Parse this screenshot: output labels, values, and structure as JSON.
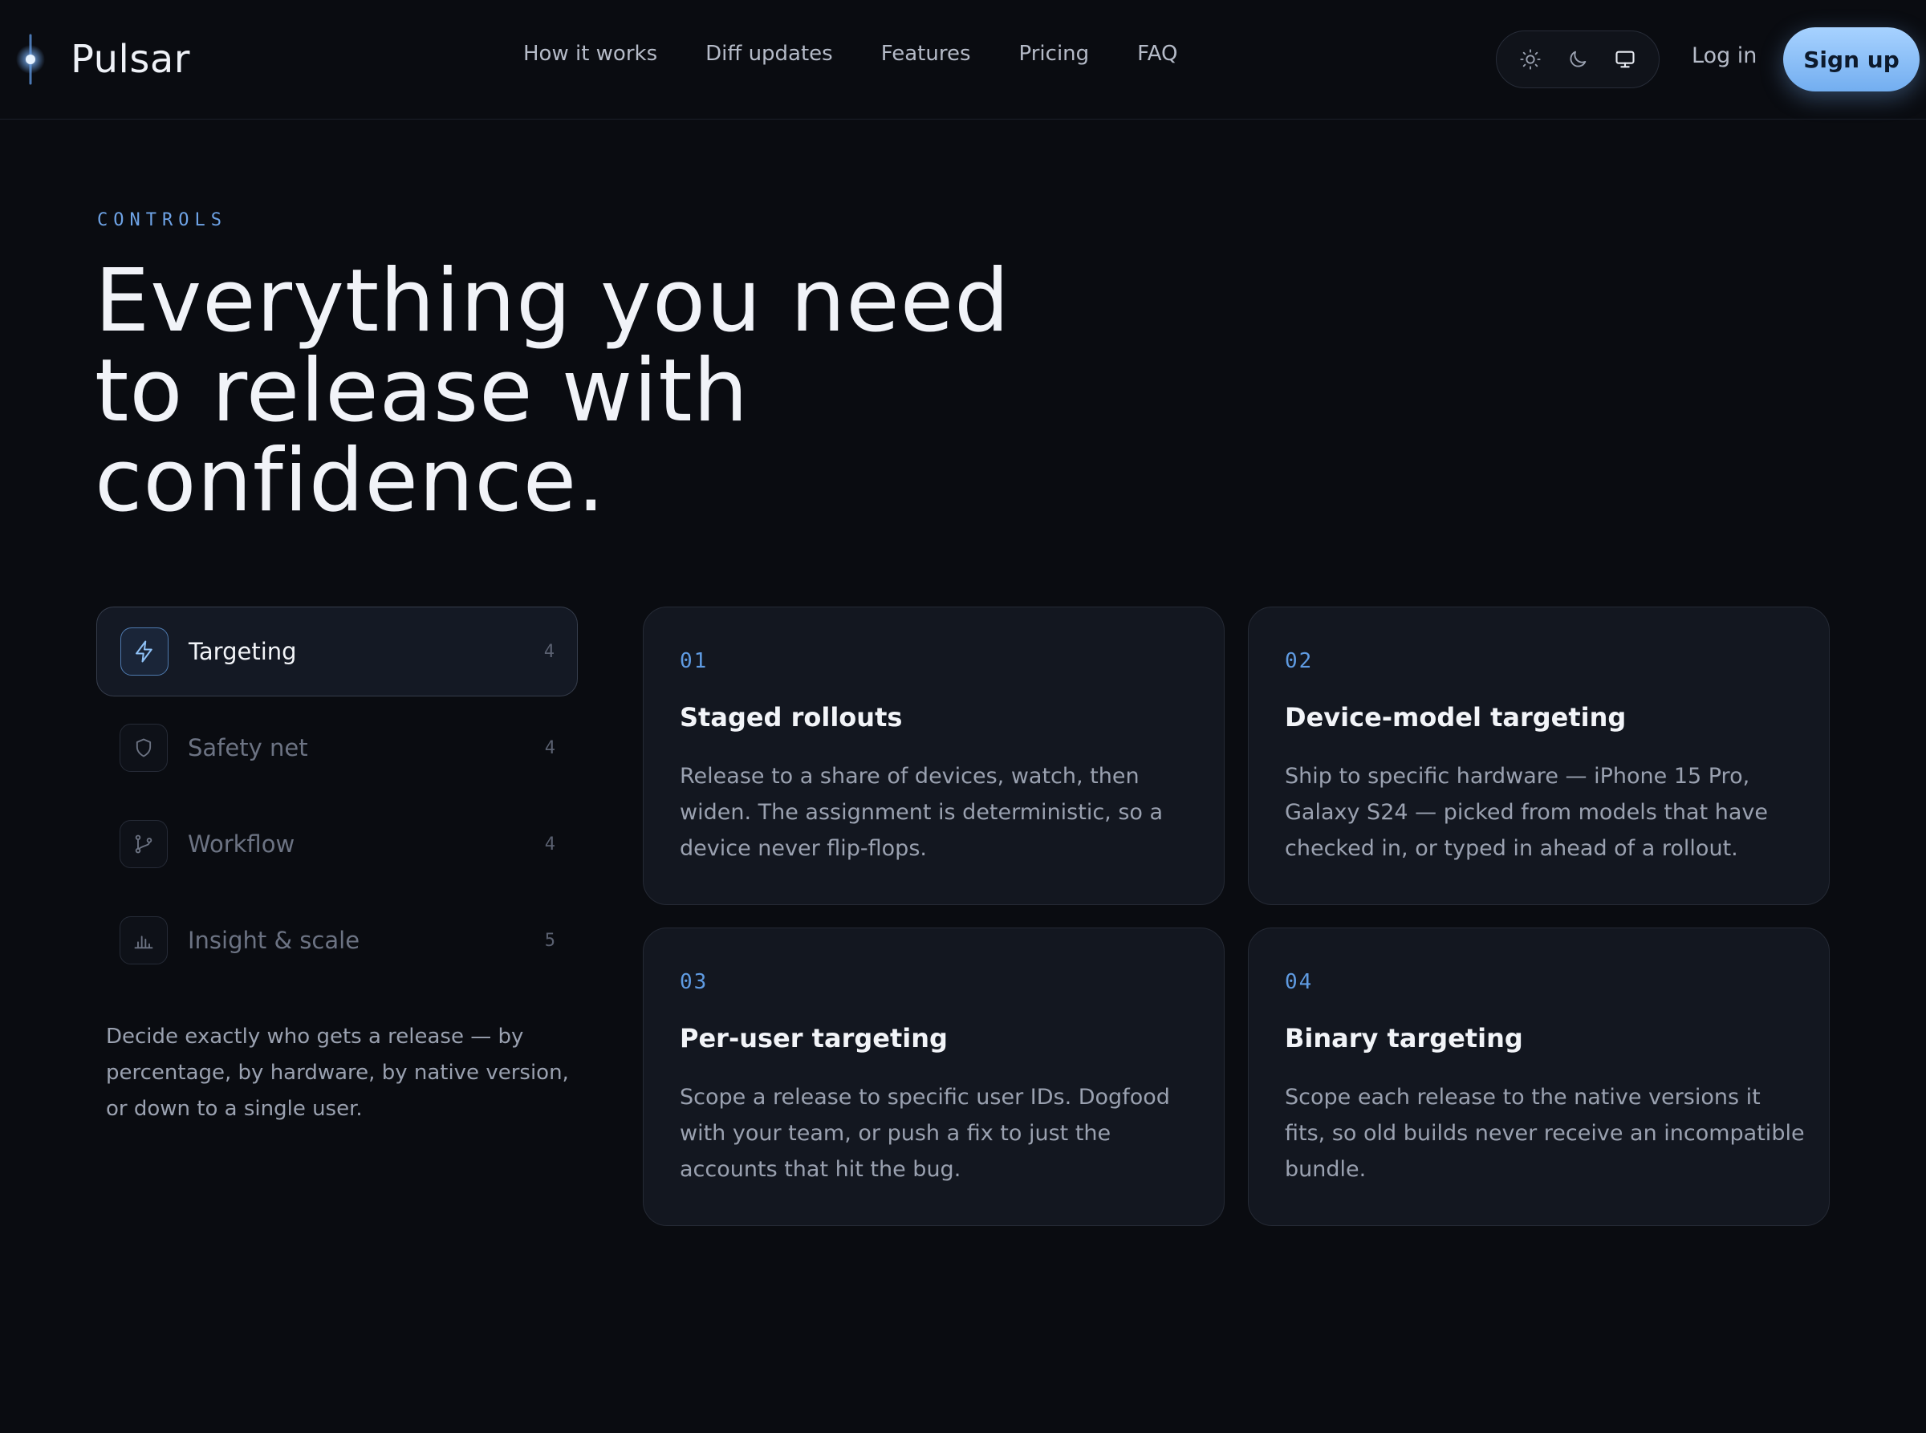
{
  "header": {
    "brand": "Pulsar",
    "nav": [
      "How it works",
      "Diff updates",
      "Features",
      "Pricing",
      "FAQ"
    ],
    "theme_options": [
      "light",
      "dark",
      "system"
    ],
    "theme_selected": "system",
    "login_label": "Log in",
    "signup_label": "Sign up"
  },
  "hero": {
    "eyebrow": "CONTROLS",
    "headline": "Everything you need to release with confidence."
  },
  "sidebar": {
    "items": [
      {
        "label": "Targeting",
        "count": "4",
        "icon": "bolt-icon",
        "active": true
      },
      {
        "label": "Safety net",
        "count": "4",
        "icon": "shield-icon",
        "active": false
      },
      {
        "label": "Workflow",
        "count": "4",
        "icon": "git-branch-icon",
        "active": false
      },
      {
        "label": "Insight & scale",
        "count": "5",
        "icon": "bar-chart-icon",
        "active": false
      }
    ],
    "description": "Decide exactly who gets a release — by percentage, by hardware, by native version, or down to a single user."
  },
  "cards": [
    {
      "num": "01",
      "title": "Staged rollouts",
      "text": "Release to a share of devices, watch, then widen. The assignment is deterministic, so a device never flip-flops."
    },
    {
      "num": "02",
      "title": "Device-model targeting",
      "text": "Ship to specific hardware — iPhone 15 Pro, Galaxy S24 — picked from models that have checked in, or typed in ahead of a rollout."
    },
    {
      "num": "03",
      "title": "Per-user targeting",
      "text": "Scope a release to specific user IDs. Dogfood with your team, or push a fix to just the accounts that hit the bug."
    },
    {
      "num": "04",
      "title": "Binary targeting",
      "text": "Scope each release to the native versions it fits, so old builds never receive an incompatible bundle."
    }
  ],
  "colors": {
    "background": "#0a0c11",
    "accent": "#6ea3e6",
    "signup_gradient_top": "#a7d2ff",
    "signup_gradient_bottom": "#73aef0"
  }
}
